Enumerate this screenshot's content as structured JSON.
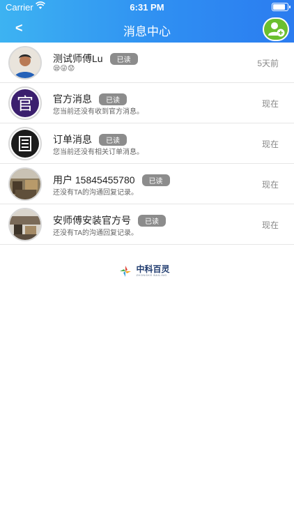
{
  "status_bar": {
    "carrier": "Carrier",
    "time": "6:31 PM",
    "battery_level": 0.85
  },
  "header": {
    "back_label": "<",
    "title": "消息中心",
    "add_icon": "add-user-icon"
  },
  "messages": [
    {
      "name": "测试师傅Lu",
      "badge": "已读",
      "preview": "😪😜😟",
      "time": "5天前",
      "avatar": "person-photo"
    },
    {
      "name": "官方消息",
      "badge": "已读",
      "preview": "您当前还没有收到官方消息。",
      "time": "现在",
      "avatar": "官"
    },
    {
      "name": "订单消息",
      "badge": "已读",
      "preview": "您当前还没有相关订单消息。",
      "time": "现在",
      "avatar": "document-icon"
    },
    {
      "name": "用户 15845455780",
      "badge": "已读",
      "preview": "还没有TA的沟通回复记录。",
      "time": "现在",
      "avatar": "photo"
    },
    {
      "name": "安师傅安装官方号",
      "badge": "已读",
      "preview": "还没有TA的沟通回复记录。",
      "time": "现在",
      "avatar": "photo"
    }
  ],
  "footer_logo": {
    "text": "中科百灵",
    "subtext": "ZHONGKE BAILING"
  },
  "colors": {
    "header_start": "#3db3f2",
    "header_end": "#2b7cf0",
    "add_button": "#6bbf2f",
    "badge": "#8c8c8c"
  }
}
